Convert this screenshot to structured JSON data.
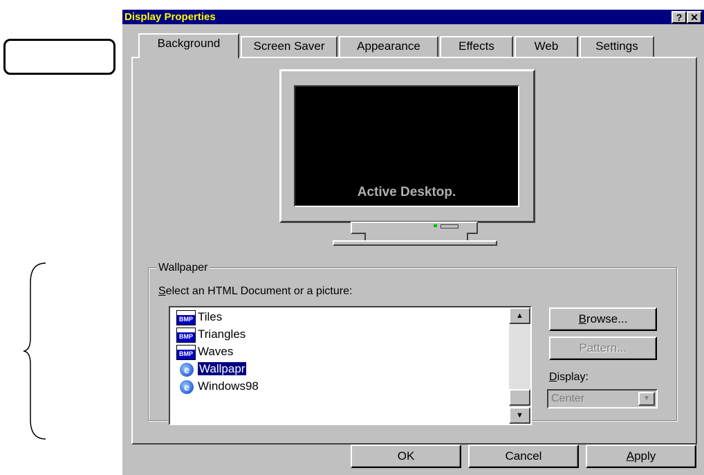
{
  "window": {
    "title": "Display Properties",
    "help_button": "?",
    "close_button": "✕"
  },
  "tabs": [
    {
      "label": "Background",
      "active": true
    },
    {
      "label": "Screen Saver",
      "active": false
    },
    {
      "label": "Appearance",
      "active": false
    },
    {
      "label": "Effects",
      "active": false
    },
    {
      "label": "Web",
      "active": false
    },
    {
      "label": "Settings",
      "active": false
    }
  ],
  "preview": {
    "screen_text": "Active Desktop."
  },
  "wallpaper": {
    "group_label": "Wallpaper",
    "select_label": "Select an HTML Document or a picture:",
    "items": [
      {
        "label": "Tiles",
        "icon": "bmp-icon",
        "selected": false
      },
      {
        "label": "Triangles",
        "icon": "bmp-icon",
        "selected": false
      },
      {
        "label": "Waves",
        "icon": "bmp-icon",
        "selected": false
      },
      {
        "label": "Wallpapr",
        "icon": "ie-html-icon",
        "selected": true
      },
      {
        "label": "Windows98",
        "icon": "ie-html-icon",
        "selected": false
      }
    ],
    "browse_label": "Browse...",
    "pattern_label": "Pattern...",
    "display_label": "Display:",
    "display_value": "Center"
  },
  "footer": {
    "ok_label": "OK",
    "cancel_label": "Cancel",
    "apply_label": "Apply"
  },
  "colors": {
    "title_bar": "#000080",
    "title_text": "#ffff00",
    "face": "#c0c0c0",
    "selection": "#000080"
  }
}
